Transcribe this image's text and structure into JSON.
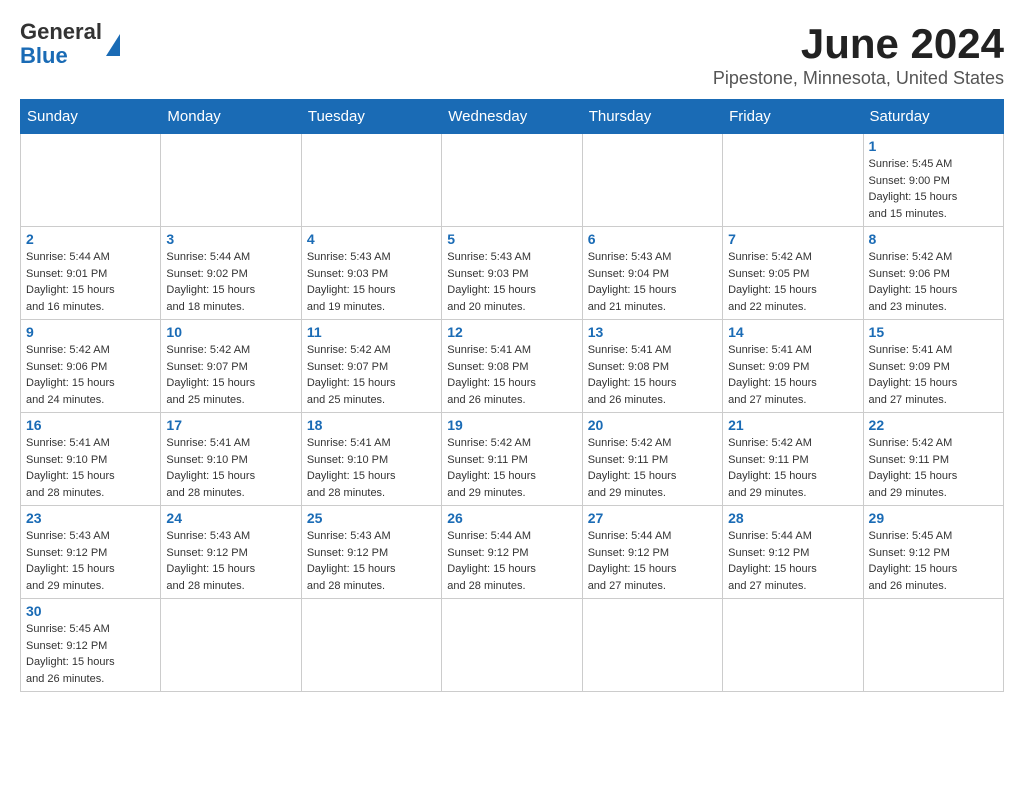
{
  "header": {
    "logo_general": "General",
    "logo_blue": "Blue",
    "month_title": "June 2024",
    "location": "Pipestone, Minnesota, United States"
  },
  "weekdays": [
    "Sunday",
    "Monday",
    "Tuesday",
    "Wednesday",
    "Thursday",
    "Friday",
    "Saturday"
  ],
  "weeks": [
    [
      {
        "day": "",
        "info": ""
      },
      {
        "day": "",
        "info": ""
      },
      {
        "day": "",
        "info": ""
      },
      {
        "day": "",
        "info": ""
      },
      {
        "day": "",
        "info": ""
      },
      {
        "day": "",
        "info": ""
      },
      {
        "day": "1",
        "info": "Sunrise: 5:45 AM\nSunset: 9:00 PM\nDaylight: 15 hours\nand 15 minutes."
      }
    ],
    [
      {
        "day": "2",
        "info": "Sunrise: 5:44 AM\nSunset: 9:01 PM\nDaylight: 15 hours\nand 16 minutes."
      },
      {
        "day": "3",
        "info": "Sunrise: 5:44 AM\nSunset: 9:02 PM\nDaylight: 15 hours\nand 18 minutes."
      },
      {
        "day": "4",
        "info": "Sunrise: 5:43 AM\nSunset: 9:03 PM\nDaylight: 15 hours\nand 19 minutes."
      },
      {
        "day": "5",
        "info": "Sunrise: 5:43 AM\nSunset: 9:03 PM\nDaylight: 15 hours\nand 20 minutes."
      },
      {
        "day": "6",
        "info": "Sunrise: 5:43 AM\nSunset: 9:04 PM\nDaylight: 15 hours\nand 21 minutes."
      },
      {
        "day": "7",
        "info": "Sunrise: 5:42 AM\nSunset: 9:05 PM\nDaylight: 15 hours\nand 22 minutes."
      },
      {
        "day": "8",
        "info": "Sunrise: 5:42 AM\nSunset: 9:06 PM\nDaylight: 15 hours\nand 23 minutes."
      }
    ],
    [
      {
        "day": "9",
        "info": "Sunrise: 5:42 AM\nSunset: 9:06 PM\nDaylight: 15 hours\nand 24 minutes."
      },
      {
        "day": "10",
        "info": "Sunrise: 5:42 AM\nSunset: 9:07 PM\nDaylight: 15 hours\nand 25 minutes."
      },
      {
        "day": "11",
        "info": "Sunrise: 5:42 AM\nSunset: 9:07 PM\nDaylight: 15 hours\nand 25 minutes."
      },
      {
        "day": "12",
        "info": "Sunrise: 5:41 AM\nSunset: 9:08 PM\nDaylight: 15 hours\nand 26 minutes."
      },
      {
        "day": "13",
        "info": "Sunrise: 5:41 AM\nSunset: 9:08 PM\nDaylight: 15 hours\nand 26 minutes."
      },
      {
        "day": "14",
        "info": "Sunrise: 5:41 AM\nSunset: 9:09 PM\nDaylight: 15 hours\nand 27 minutes."
      },
      {
        "day": "15",
        "info": "Sunrise: 5:41 AM\nSunset: 9:09 PM\nDaylight: 15 hours\nand 27 minutes."
      }
    ],
    [
      {
        "day": "16",
        "info": "Sunrise: 5:41 AM\nSunset: 9:10 PM\nDaylight: 15 hours\nand 28 minutes."
      },
      {
        "day": "17",
        "info": "Sunrise: 5:41 AM\nSunset: 9:10 PM\nDaylight: 15 hours\nand 28 minutes."
      },
      {
        "day": "18",
        "info": "Sunrise: 5:41 AM\nSunset: 9:10 PM\nDaylight: 15 hours\nand 28 minutes."
      },
      {
        "day": "19",
        "info": "Sunrise: 5:42 AM\nSunset: 9:11 PM\nDaylight: 15 hours\nand 29 minutes."
      },
      {
        "day": "20",
        "info": "Sunrise: 5:42 AM\nSunset: 9:11 PM\nDaylight: 15 hours\nand 29 minutes."
      },
      {
        "day": "21",
        "info": "Sunrise: 5:42 AM\nSunset: 9:11 PM\nDaylight: 15 hours\nand 29 minutes."
      },
      {
        "day": "22",
        "info": "Sunrise: 5:42 AM\nSunset: 9:11 PM\nDaylight: 15 hours\nand 29 minutes."
      }
    ],
    [
      {
        "day": "23",
        "info": "Sunrise: 5:43 AM\nSunset: 9:12 PM\nDaylight: 15 hours\nand 29 minutes."
      },
      {
        "day": "24",
        "info": "Sunrise: 5:43 AM\nSunset: 9:12 PM\nDaylight: 15 hours\nand 28 minutes."
      },
      {
        "day": "25",
        "info": "Sunrise: 5:43 AM\nSunset: 9:12 PM\nDaylight: 15 hours\nand 28 minutes."
      },
      {
        "day": "26",
        "info": "Sunrise: 5:44 AM\nSunset: 9:12 PM\nDaylight: 15 hours\nand 28 minutes."
      },
      {
        "day": "27",
        "info": "Sunrise: 5:44 AM\nSunset: 9:12 PM\nDaylight: 15 hours\nand 27 minutes."
      },
      {
        "day": "28",
        "info": "Sunrise: 5:44 AM\nSunset: 9:12 PM\nDaylight: 15 hours\nand 27 minutes."
      },
      {
        "day": "29",
        "info": "Sunrise: 5:45 AM\nSunset: 9:12 PM\nDaylight: 15 hours\nand 26 minutes."
      }
    ],
    [
      {
        "day": "30",
        "info": "Sunrise: 5:45 AM\nSunset: 9:12 PM\nDaylight: 15 hours\nand 26 minutes."
      },
      {
        "day": "",
        "info": ""
      },
      {
        "day": "",
        "info": ""
      },
      {
        "day": "",
        "info": ""
      },
      {
        "day": "",
        "info": ""
      },
      {
        "day": "",
        "info": ""
      },
      {
        "day": "",
        "info": ""
      }
    ]
  ]
}
